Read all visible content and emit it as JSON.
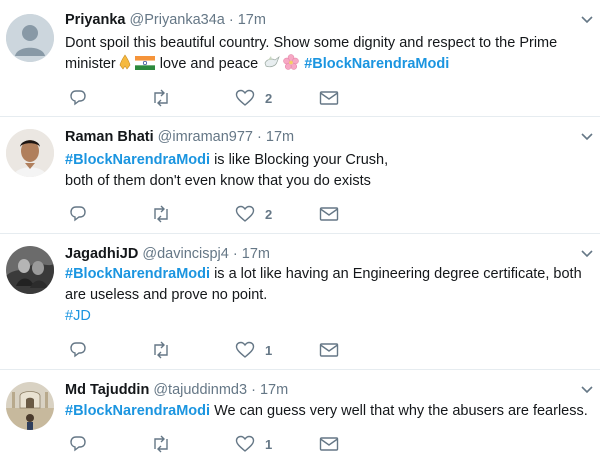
{
  "tweets": [
    {
      "name": "Priyanka",
      "handle": "@Priyanka34a",
      "separator": "·",
      "time": "17m",
      "text1": "Dont spoil this beautiful country. Show some dignity and respect to the Prime",
      "text2a": "minister",
      "text2b": " love and peace ",
      "hashtag": "#BlockNarendraModi",
      "reply_count": "",
      "retweet_count": "",
      "like_count": "2",
      "avatar_icon": "default-avatar-icon"
    },
    {
      "name": "Raman Bhati",
      "handle": "@imraman977",
      "separator": "·",
      "time": "17m",
      "hashtag": "#BlockNarendraModi",
      "text1": " is like Blocking your Crush,",
      "text2": "both of them don't even know that you do exists",
      "like_count": "2",
      "avatar_icon": "user-photo-avatar"
    },
    {
      "name": "JagadhiJD",
      "handle": "@davincispj4",
      "separator": "·",
      "time": "17m",
      "hashtag": "#BlockNarendraModi",
      "text1": " is a lot like having an Engineering degree certificate, both",
      "text2": "are useless and prove no point.",
      "hashtag2": "#JD",
      "like_count": "1",
      "avatar_icon": "user-photo-avatar"
    },
    {
      "name": "Md Tajuddin",
      "handle": "@tajuddinmd3",
      "separator": "·",
      "time": "17m",
      "hashtag": "#BlockNarendraModi",
      "text1": " We can guess very well that why the abusers are fearless.",
      "like_count": "1",
      "avatar_icon": "user-photo-avatar"
    }
  ],
  "colors": {
    "link": "#1b95e0",
    "muted": "#657786",
    "text": "#14171a",
    "divider": "#e6ecf0"
  }
}
